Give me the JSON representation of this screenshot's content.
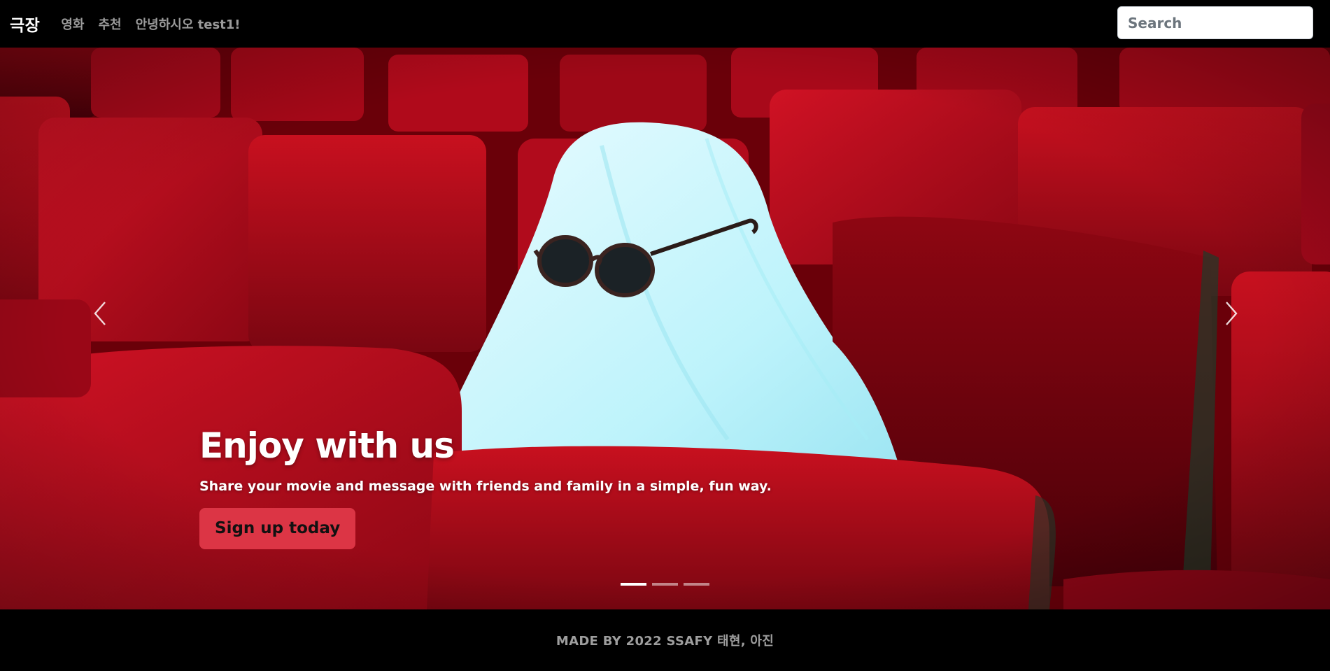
{
  "navbar": {
    "brand": "극장",
    "links": [
      "영화",
      "추천",
      "안녕하시오 test1!"
    ],
    "search": {
      "placeholder": "Search",
      "value": ""
    }
  },
  "carousel": {
    "slide": {
      "title": "Enjoy with us",
      "subtitle": "Share your movie and message with friends and family in a simple, fun way.",
      "cta_label": "Sign up today"
    },
    "prev_icon": "chevron-left-icon",
    "next_icon": "chevron-right-icon",
    "indicators": {
      "count": 3,
      "active": 0
    }
  },
  "footer": {
    "text": "MADE BY 2022 SSAFY 태현, 아진"
  },
  "colors": {
    "background": "#000000",
    "accent": "#dc3545",
    "nav_link": "#9b9b9b",
    "seat_red": "#b40514"
  }
}
